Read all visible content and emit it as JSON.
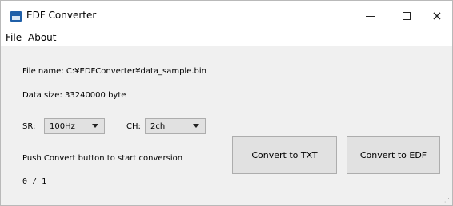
{
  "window": {
    "title": "EDF Converter",
    "icon": "disk-app-icon",
    "controls": {
      "minimize": "minimize-icon",
      "maximize": "maximize-icon",
      "close": "×"
    }
  },
  "menu": {
    "file": "File",
    "about": "About"
  },
  "main": {
    "file_name": "File name: C:¥EDFConverter¥data_sample.bin",
    "data_size": "Data size: 33240000 byte",
    "sr_label": "SR:",
    "sr_value": "100Hz",
    "ch_label": "CH:",
    "ch_value": "2ch",
    "status": "Push Convert button to start conversion",
    "progress": "0 / 1",
    "convert_txt": "Convert to TXT",
    "convert_edf": "Convert to EDF"
  },
  "colors": {
    "window_bg": "#f0f0f0",
    "titlebar_bg": "#ffffff",
    "button_bg": "#e1e1e1",
    "button_border": "#adadad",
    "icon_blue": "#1f5fa8"
  }
}
